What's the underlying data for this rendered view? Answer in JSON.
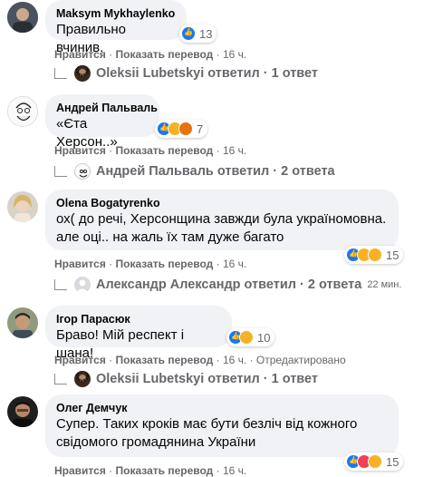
{
  "comments": [
    {
      "author": "Maksym Mykhaylenko",
      "text": "Правильно вчинив.",
      "reaction_count": "13",
      "reactions": [
        "like"
      ],
      "actions": {
        "like": "Нравится",
        "translate": "Показать перевод",
        "time": "16 ч."
      },
      "edited": "",
      "reply_summary": "Oleksii Lubetskyi ответил · 1 ответ",
      "reply_time": ""
    },
    {
      "author": "Андрей Пальваль",
      "text": "«Єта Херсон..»",
      "reaction_count": "7",
      "reactions": [
        "like",
        "haha",
        "angry"
      ],
      "actions": {
        "like": "Нравится",
        "translate": "Показать перевод",
        "time": "16 ч."
      },
      "edited": "",
      "reply_summary": "Андрей Пальваль ответил · 2 ответа",
      "reply_time": ""
    },
    {
      "author": "Olena Bogatyrenko",
      "text_lines": [
        "ох( до речі, Херсонщина завжди була україномовна.",
        "але оці.. на жаль їх там дуже багато"
      ],
      "reaction_count": "15",
      "reactions": [
        "like",
        "wow",
        "haha"
      ],
      "actions": {
        "like": "Нравится",
        "translate": "Показать перевод",
        "time": "16 ч."
      },
      "edited": "",
      "reply_summary": "Александр Александр ответил · 2 ответа",
      "reply_time": "22 мин."
    },
    {
      "author": "Ігор Парасюк",
      "text": "Браво! Мій респект і шана!",
      "reaction_count": "10",
      "reactions": [
        "like",
        "care"
      ],
      "actions": {
        "like": "Нравится",
        "translate": "Показать перевод",
        "time": "16 ч."
      },
      "edited": "Отредактировано",
      "reply_summary": "Oleksii Lubetskyi ответил · 1 ответ",
      "reply_time": ""
    },
    {
      "author": "Олег Демчук",
      "text_lines": [
        "Супер. Таких кроків має бути безліч від кожного",
        "свідомого громадянина України"
      ],
      "reaction_count": "15",
      "reactions": [
        "like",
        "love",
        "care"
      ],
      "actions": {
        "like": "Нравится",
        "translate": "Показать перевод",
        "time": "16 ч."
      },
      "edited": "",
      "reply_summary": "",
      "reply_time": ""
    }
  ],
  "colors": {
    "bubble": "#f0f2f5",
    "like_blue": "#1877f2",
    "meta_gray": "#65676b"
  }
}
